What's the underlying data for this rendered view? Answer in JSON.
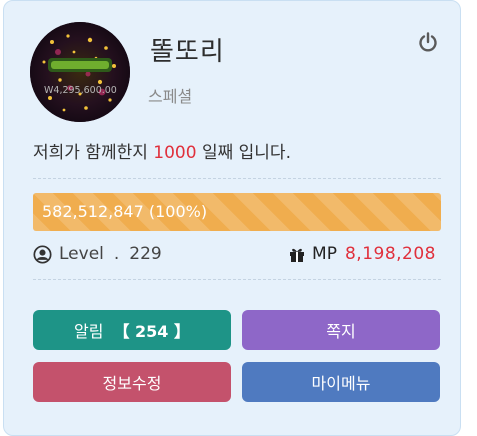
{
  "profile": {
    "nickname": "똘또리",
    "grade": "스페셜",
    "avatar_caption": "W4,295,600.00"
  },
  "icons": {
    "logout": "power-icon",
    "user": "user-circle-icon",
    "gift": "gift-icon"
  },
  "days": {
    "prefix": "저희가 함께한지",
    "count": "1000",
    "suffix": "일째 입니다."
  },
  "experience": {
    "text": "582,512,847 (100%)",
    "percent": 100
  },
  "level": {
    "label": "Level",
    "separator": ".",
    "value": "229"
  },
  "mp": {
    "label": "MP",
    "value": "8,198,208"
  },
  "buttons": {
    "alarm_label": "알림",
    "alarm_count": "【 254 】",
    "memo_label": "쪽지",
    "info_label": "정보수정",
    "mymenu_label": "마이메뉴"
  },
  "colors": {
    "panel_bg": "#e6f1fb",
    "progress": "#f0ad4e",
    "highlight_red": "#e0303c",
    "alarm_button": "#1e9487",
    "memo_button": "#8e67c8",
    "info_button": "#c4526c",
    "mymenu_button": "#4f7ac0"
  }
}
